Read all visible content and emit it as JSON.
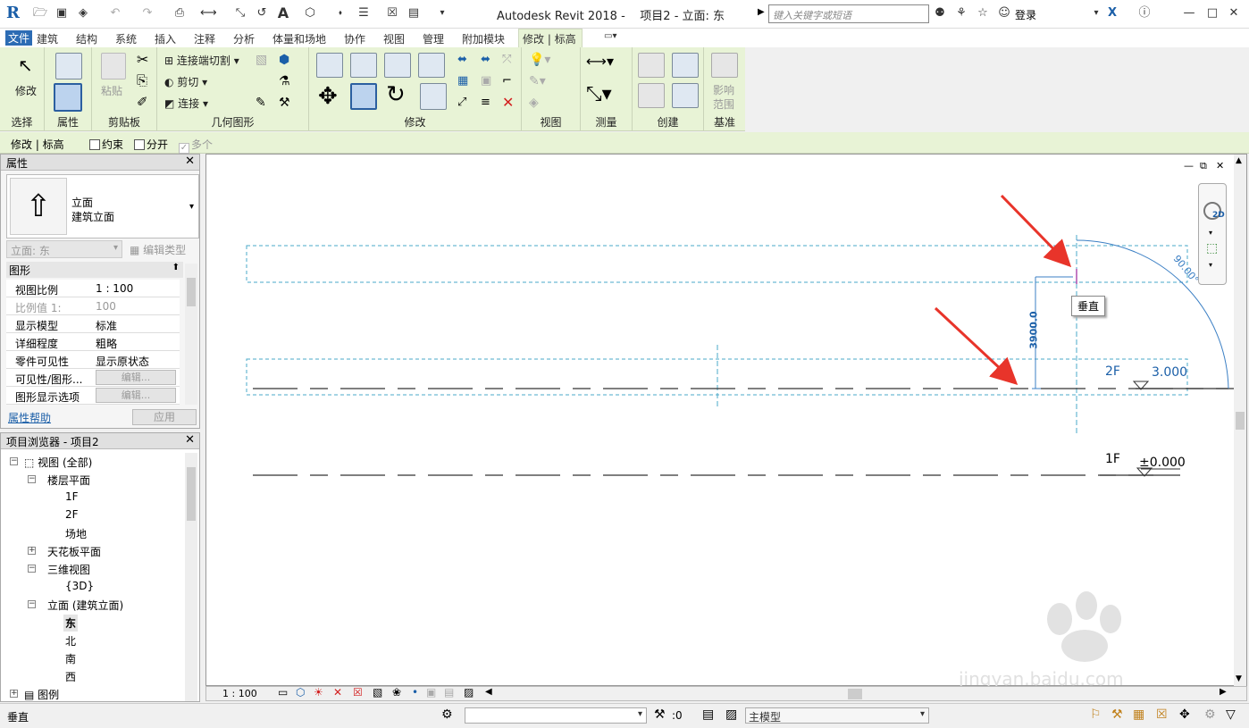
{
  "app": {
    "title": "Autodesk Revit 2018 -",
    "doc": "项目2 - 立面: 东",
    "search_placeholder": "键入关键字或短语",
    "signin": "登录",
    "logo": "R"
  },
  "tabs": [
    "文件",
    "建筑",
    "结构",
    "系统",
    "插入",
    "注释",
    "分析",
    "体量和场地",
    "协作",
    "视图",
    "管理",
    "附加模块",
    "修改 | 标高"
  ],
  "ribbon": {
    "panels": [
      "选择",
      "属性",
      "剪贴板",
      "几何图形",
      "修改",
      "视图",
      "测量",
      "创建",
      "基准"
    ],
    "modify": "修改",
    "paste": "粘贴",
    "join_cut": "连接端切割",
    "cut": "剪切",
    "join": "连接",
    "influence_1": "影响",
    "influence_2": "范围"
  },
  "options": {
    "context": "修改 | 标高",
    "constrain": "约束",
    "split": "分开",
    "multiple": "多个"
  },
  "properties": {
    "title": "属性",
    "type_line1": "立面",
    "type_line2": "建筑立面",
    "instance": "立面: 东",
    "edit_type": "编辑类型",
    "group": "图形",
    "rows": [
      {
        "k": "视图比例",
        "v": "1 : 100"
      },
      {
        "k": "比例值 1:",
        "v": "100"
      },
      {
        "k": "显示模型",
        "v": "标准"
      },
      {
        "k": "详细程度",
        "v": "粗略"
      },
      {
        "k": "零件可见性",
        "v": "显示原状态"
      },
      {
        "k": "可见性/图形...",
        "v": "编辑..."
      },
      {
        "k": "图形显示选项",
        "v": "编辑..."
      }
    ],
    "help": "属性帮助",
    "apply": "应用"
  },
  "browser": {
    "title": "项目浏览器 - 项目2",
    "nodes": [
      "视图 (全部)",
      "楼层平面",
      "1F",
      "2F",
      "场地",
      "天花板平面",
      "三维视图",
      "{3D}",
      "立面 (建筑立面)",
      "东",
      "北",
      "南",
      "西",
      "图例"
    ]
  },
  "drawing": {
    "level_upper": {
      "name": "2F",
      "elev": "3.000"
    },
    "level_lower": {
      "name": "1F",
      "elev": "±0.000"
    },
    "dimension": "3900.0",
    "angle": "90.00°",
    "tooltip": "垂直",
    "nav_2d": "2D",
    "watermark_url": "jingyan.baidu.com"
  },
  "viewbar": {
    "scale": "1 : 100"
  },
  "status": {
    "text": "垂直",
    "sel": ":0",
    "model": "主模型"
  },
  "colors": {
    "ribbon": "#e8f3d6",
    "selection": "#3b7fc4",
    "arrow": "#e8342a"
  }
}
